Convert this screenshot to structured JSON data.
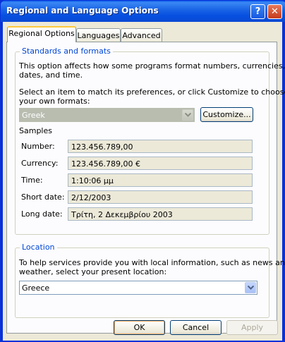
{
  "window": {
    "title": "Regional and Language Options",
    "help_glyph": "?",
    "close_glyph": "✕"
  },
  "tabs": [
    {
      "label": "Regional Options",
      "active": true
    },
    {
      "label": "Languages",
      "active": false
    },
    {
      "label": "Advanced",
      "active": false
    }
  ],
  "standards": {
    "group_label": "Standards and formats",
    "description_line1": "This option affects how some programs format numbers, currencies,",
    "description_line2": "dates, and time.",
    "select_line1": "Select an item to match its preferences, or click Customize to choose",
    "select_line2": "your own formats:",
    "locale_value": "Greek",
    "customize_label": "Customize...",
    "samples_label": "Samples",
    "samples": [
      {
        "label": "Number:",
        "value": "123.456.789,00"
      },
      {
        "label": "Currency:",
        "value": "123.456.789,00 €"
      },
      {
        "label": "Time:",
        "value": "1:10:06 μμ"
      },
      {
        "label": "Short date:",
        "value": "2/12/2003"
      },
      {
        "label": "Long date:",
        "value": "Τρίτη, 2 Δεκεμβρίου 2003"
      }
    ]
  },
  "location": {
    "group_label": "Location",
    "description_line1": "To help services provide you with local information, such as news and",
    "description_line2": "weather, select your present location:",
    "value": "Greece"
  },
  "buttons": {
    "ok": "OK",
    "cancel": "Cancel",
    "apply": "Apply"
  },
  "colors": {
    "title_bar": "#0b5ae8",
    "dialog_bg": "#ece9d8",
    "group_label": "#0046d5",
    "active_tab_highlight": "#ffc83c",
    "close_button": "#c53a1a"
  }
}
